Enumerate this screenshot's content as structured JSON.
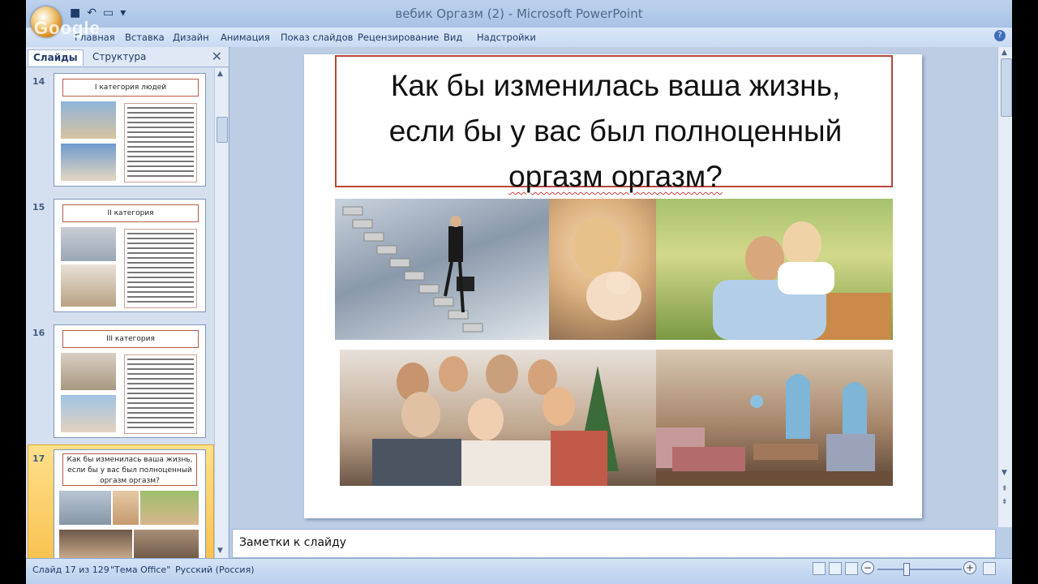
{
  "window": {
    "title": "вебик Оргазм (2)  -  Microsoft PowerPoint",
    "watermark": "Google"
  },
  "quick_access": {
    "save_icon": "save-icon",
    "undo_icon": "undo-icon",
    "redo_icon": "redo-icon",
    "customize_icon": "chevron-down-icon"
  },
  "menu": {
    "tabs": [
      "Главная",
      "Вставка",
      "Дизайн",
      "Анимация",
      "Показ слайдов",
      "Рецензирование",
      "Вид",
      "Надстройки"
    ]
  },
  "left_pane": {
    "tabs": {
      "slides": "Слайды",
      "outline": "Структура"
    },
    "thumbnails": [
      {
        "number": "14",
        "title": "I категория людей"
      },
      {
        "number": "15",
        "title": "II категория"
      },
      {
        "number": "16",
        "title": "III категория"
      },
      {
        "number": "17",
        "title": "Как бы изменилась ваша жизнь, если бы у вас был полноценный оргазм оргазм?",
        "selected": true
      }
    ]
  },
  "slide": {
    "title_line1": "Как бы изменилась ваша жизнь,",
    "title_line2": "если бы у вас был полноценный",
    "title_line3": "оргазм оргазм?"
  },
  "notes": {
    "placeholder": "Заметки к слайду"
  },
  "status": {
    "slide_pos": "Слайд 17 из 129",
    "theme": "\"Тема Office\"",
    "language": "Русский (Россия)"
  },
  "colors": {
    "title_border": "#b7473a",
    "ribbon": "#c8daf2",
    "selection": "#f8c250"
  }
}
